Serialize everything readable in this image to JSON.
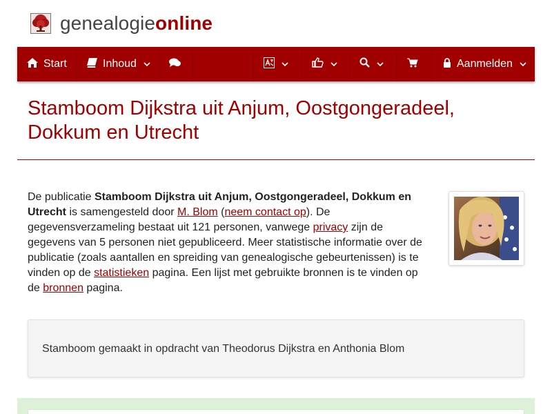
{
  "logo": {
    "text_light": "genealogie",
    "text_strong": "online"
  },
  "nav": {
    "start_label": "Start",
    "inhoud_label": "Inhoud",
    "login_label": "Aanmelden"
  },
  "page": {
    "title": "Stamboom Dijkstra uit Anjum, Oostgongeradeel, Dokkum en Utrecht"
  },
  "intro": {
    "p1": "De publicatie ",
    "pub_name": "Stamboom Dijkstra uit Anjum, Oostgongeradeel, Dokkum en Utrecht",
    "p2": " is samengesteld door ",
    "author_link": "M. Blom",
    "p3": " (",
    "contact_link": "neem contact op",
    "p4": "). De gegevensverzameling bestaat uit 121 personen, vanwege ",
    "privacy_link": "privacy",
    "p5": " zijn de gegevens van 5 personen niet gepubliceerd. Meer statistische informatie over de publicatie (zoals aantallen en spreiding van genealogische gebeurtenissen) is te vinden op de ",
    "stats_link": "statistieken",
    "p6": " pagina. Een lijst met gebruikte bronnen is te vinden op de ",
    "sources_link": "bronnen",
    "p7": " pagina."
  },
  "description": {
    "text": "Stamboom gemaakt in opdracht van Theodorus Dijkstra en Anthonia Blom"
  },
  "colors": {
    "brand": "#a00000",
    "success_bg": "#dff0d8"
  },
  "icons": [
    "tree-logo-icon",
    "home-icon",
    "book-icon",
    "comments-icon",
    "translate-icon",
    "thumbs-up-icon",
    "search-icon",
    "cart-icon",
    "lock-icon",
    "chevron-down-icon"
  ]
}
